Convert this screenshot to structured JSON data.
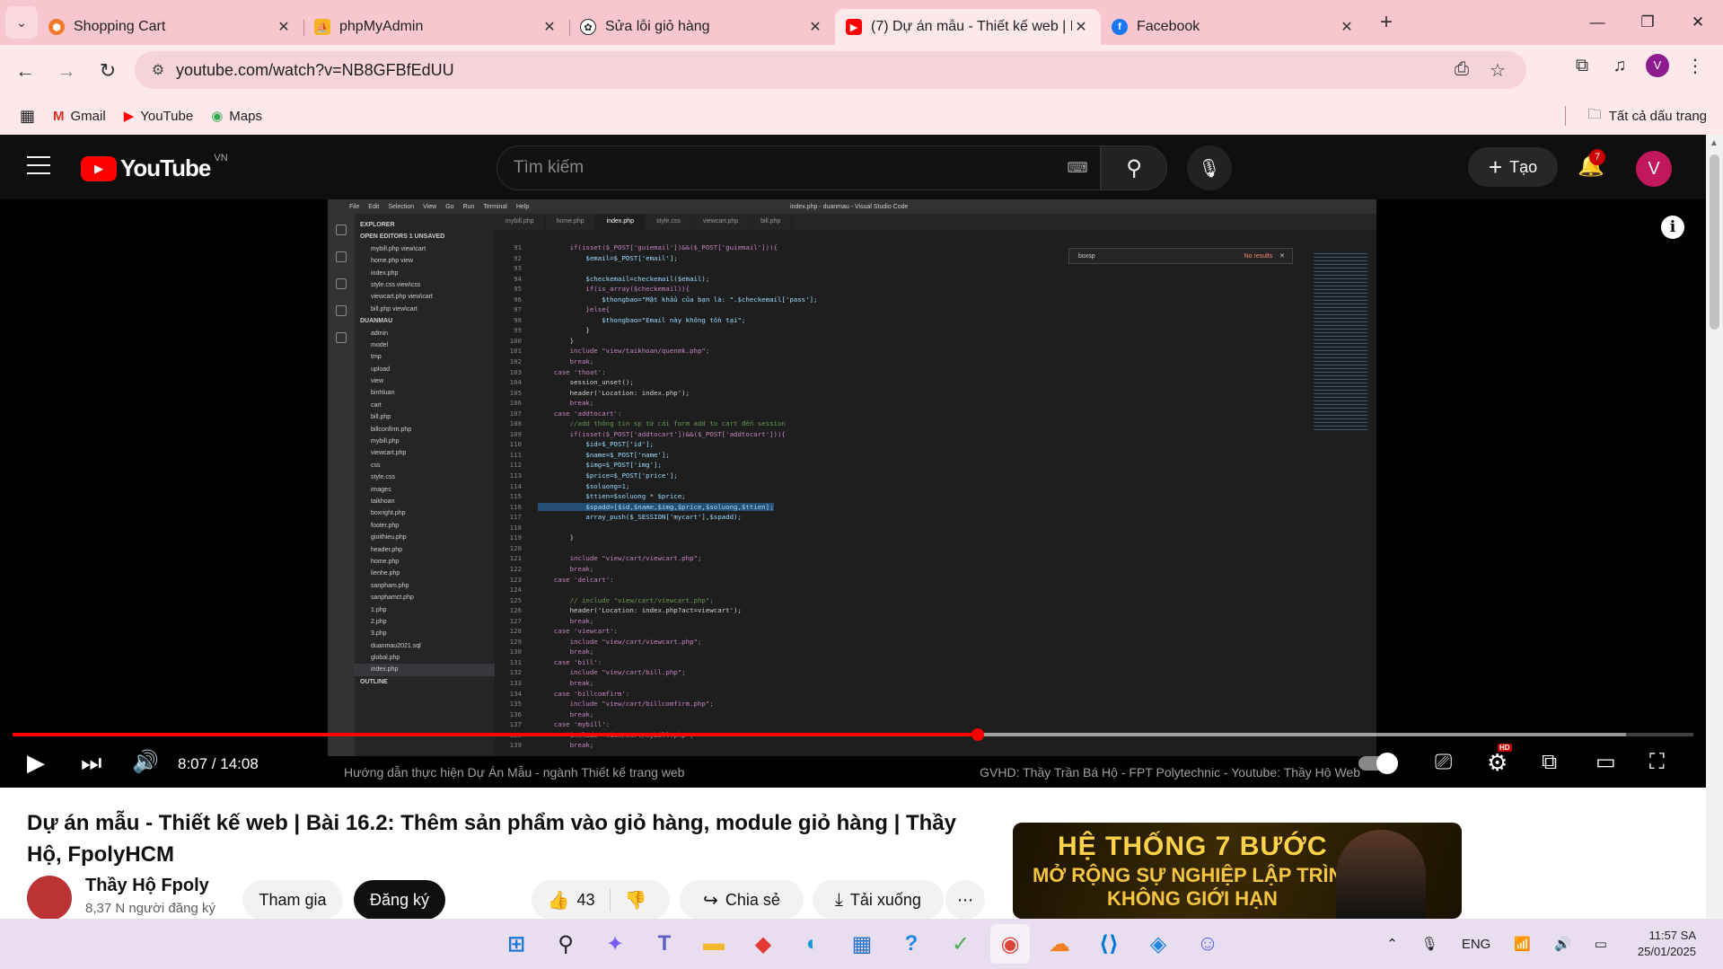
{
  "browser": {
    "tabs": [
      {
        "title": "Shopping Cart",
        "icon": "shopping-cart-favicon",
        "active": false
      },
      {
        "title": "phpMyAdmin",
        "icon": "phpmyadmin-favicon",
        "active": false
      },
      {
        "title": "Sửa lỗi giỏ hàng",
        "icon": "chatgpt-favicon",
        "active": false
      },
      {
        "title": "(7) Dự án mẫu - Thiết kế web | B",
        "icon": "youtube-favicon",
        "active": true
      },
      {
        "title": "Facebook",
        "icon": "facebook-favicon",
        "active": false
      }
    ],
    "url": "youtube.com/watch?v=NB8GFBfEdUU",
    "profile_initial": "V",
    "bookmarks": [
      {
        "label": "Gmail",
        "icon": "gmail-icon"
      },
      {
        "label": "YouTube",
        "icon": "youtube-icon"
      },
      {
        "label": "Maps",
        "icon": "maps-icon"
      }
    ],
    "all_bookmarks": "Tất cả dấu trang"
  },
  "youtube": {
    "logo_text": "YouTube",
    "region": "VN",
    "search_placeholder": "Tìm kiếm",
    "create_label": "Tạo",
    "notification_count": "7",
    "avatar_initial": "V",
    "accent_color": "#ff0000"
  },
  "player": {
    "current_time": "8:07",
    "duration": "14:08",
    "time_display": "8:07 / 14:08",
    "played_fraction": 0.574,
    "buffered_fraction": 0.96,
    "autoplay_on": true,
    "quality_badge": "HD",
    "caption_left": "Hướng dẫn thực hiện Dự Án Mẫu - ngành Thiết kế trang web",
    "caption_right": "GVHD: Thầy Trần Bá Hộ - FPT Polytechnic - Youtube: Thầy Hộ Web"
  },
  "vscode": {
    "menu": [
      "File",
      "Edit",
      "Selection",
      "View",
      "Go",
      "Run",
      "Terminal",
      "Help"
    ],
    "window_title": "index.php - duanmau - Visual Studio Code",
    "tabs": [
      "mybill.php",
      "home.php",
      "index.php",
      "style.css",
      "viewcart.php",
      "bill.php"
    ],
    "breadcrumb": "index.php",
    "find_text": "boxsp",
    "find_result": "No results",
    "explorer": [
      "EXPLORER",
      "OPEN EDITORS  1 UNSAVED",
      "mybill.php view\\cart",
      "home.php view",
      "index.php",
      "style.css view\\css",
      "viewcart.php view\\cart",
      "bill.php view\\cart",
      "DUANMAU",
      "admin",
      "model",
      "tmp",
      "upload",
      "view",
      "binhluan",
      "cart",
      "bill.php",
      "billconfirm.php",
      "mybill.php",
      "viewcart.php",
      "css",
      "style.css",
      "images",
      "taikhoan",
      "boxright.php",
      "footer.php",
      "gioithieu.php",
      "header.php",
      "home.php",
      "lienhe.php",
      "sanpham.php",
      "sanphamct.php",
      "1.php",
      "2.php",
      "3.php",
      "duanmau2021.sql",
      "global.php",
      "index.php",
      "OUTLINE"
    ],
    "code": [
      {
        "n": "91",
        "t": "        if(isset($_POST['guiemail'])&&($_POST['guiemail'])){"
      },
      {
        "n": "92",
        "t": "            $email=$_POST['email'];"
      },
      {
        "n": "93",
        "t": ""
      },
      {
        "n": "94",
        "t": "            $checkemail=checkemail($email);"
      },
      {
        "n": "95",
        "t": "            if(is_array($checkemail)){"
      },
      {
        "n": "96",
        "t": "                $thongbao=\"Mật khẩu của bạn là: \".$checkemail['pass'];"
      },
      {
        "n": "97",
        "t": "            }else{"
      },
      {
        "n": "98",
        "t": "                $thongbao=\"Email này không tồn tại\";"
      },
      {
        "n": "99",
        "t": "            }"
      },
      {
        "n": "100",
        "t": "        }"
      },
      {
        "n": "101",
        "t": "        include \"view/taikhoan/quenmk.php\";"
      },
      {
        "n": "102",
        "t": "        break;"
      },
      {
        "n": "103",
        "t": "    case 'thoat':"
      },
      {
        "n": "104",
        "t": "        session_unset();"
      },
      {
        "n": "105",
        "t": "        header('Location: index.php');"
      },
      {
        "n": "106",
        "t": "        break;"
      },
      {
        "n": "107",
        "t": "    case 'addtocart':"
      },
      {
        "n": "108",
        "t": "        //add thông tin sp từ cái form add to cart đến session"
      },
      {
        "n": "109",
        "t": "        if(isset($_POST['addtocart'])&&($_POST['addtocart'])){"
      },
      {
        "n": "110",
        "t": "            $id=$_POST['id'];"
      },
      {
        "n": "111",
        "t": "            $name=$_POST['name'];"
      },
      {
        "n": "112",
        "t": "            $img=$_POST['img'];"
      },
      {
        "n": "113",
        "t": "            $price=$_POST['price'];"
      },
      {
        "n": "114",
        "t": "            $soluong=1;"
      },
      {
        "n": "115",
        "t": "            $ttien=$soluong * $price;"
      },
      {
        "n": "116",
        "t": "            $spadd=[$id,$name,$img,$price,$soluong,$ttien];"
      },
      {
        "n": "117",
        "t": "            array_push($_SESSION['mycart'],$spadd);"
      },
      {
        "n": "118",
        "t": ""
      },
      {
        "n": "119",
        "t": "        }"
      },
      {
        "n": "120",
        "t": ""
      },
      {
        "n": "121",
        "t": "        include \"view/cart/viewcart.php\";"
      },
      {
        "n": "122",
        "t": "        break;"
      },
      {
        "n": "123",
        "t": "    case 'delcart':"
      },
      {
        "n": "124",
        "t": ""
      },
      {
        "n": "125",
        "t": "        // include \"view/cart/viewcart.php\";"
      },
      {
        "n": "126",
        "t": "        header('Location: index.php?act=viewcart');"
      },
      {
        "n": "127",
        "t": "        break;"
      },
      {
        "n": "128",
        "t": "    case 'viewcart':"
      },
      {
        "n": "129",
        "t": "        include \"view/cart/viewcart.php\";"
      },
      {
        "n": "130",
        "t": "        break;"
      },
      {
        "n": "131",
        "t": "    case 'bill':"
      },
      {
        "n": "132",
        "t": "        include \"view/cart/bill.php\";"
      },
      {
        "n": "133",
        "t": "        break;"
      },
      {
        "n": "134",
        "t": "    case 'billcomfirm':"
      },
      {
        "n": "135",
        "t": "        include \"view/cart/billcomfirm.php\";"
      },
      {
        "n": "136",
        "t": "        break;"
      },
      {
        "n": "137",
        "t": "    case 'mybill':"
      },
      {
        "n": "138",
        "t": "        include \"view/cart/mybill.php\";"
      },
      {
        "n": "139",
        "t": "        break;"
      }
    ]
  },
  "video": {
    "title": "Dự án mẫu - Thiết kế web | Bài 16.2: Thêm sản phẩm vào giỏ hàng, module giỏ hàng | Thầy Hộ, FpolyHCM",
    "channel": "Thầy Hộ Fpoly",
    "subscribers": "8,37 N người đăng ký",
    "join_label": "Tham gia",
    "subscribe_label": "Đăng ký",
    "likes": "43",
    "share_label": "Chia sẻ",
    "download_label": "Tải xuống",
    "more_label": "⋯"
  },
  "ad": {
    "line1": "HỆ THỐNG 7 BƯỚC",
    "line2": "MỞ RỘNG SỰ NGHIỆP LẬP TRÌNH",
    "line3": "KHÔNG GIỚI HẠN"
  },
  "taskbar": {
    "apps": [
      "windows-start-icon",
      "search-icon",
      "copilot-icon",
      "teams-icon",
      "file-explorer-icon",
      "app-red-icon",
      "edge-icon",
      "store-icon",
      "help-icon",
      "app-green-icon",
      "chrome-icon",
      "cloudflare-icon",
      "vscode-icon",
      "app-blue-icon",
      "discord-icon"
    ],
    "language": "ENG",
    "time": "11:57 SA",
    "date": "25/01/2025"
  }
}
